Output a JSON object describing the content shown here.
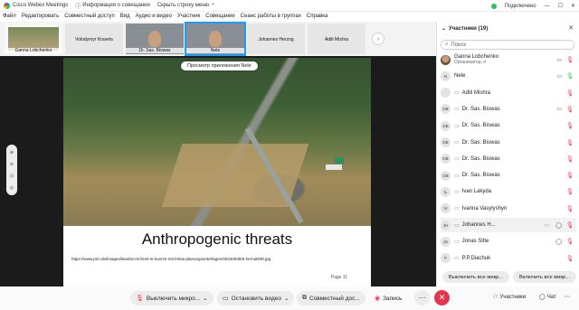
{
  "titlebar": {
    "app_name": "Cisco Webex Meetings",
    "info": "Информация о совещании",
    "hide_strip": "Скрыть строку меню",
    "status": "Подключено"
  },
  "menu": [
    "Файл",
    "Редактировать",
    "Совместный доступ",
    "Вид",
    "Аудио и видео",
    "Участник",
    "Совещание",
    "Сеанс работы в группах",
    "Справка"
  ],
  "strip": {
    "tiles": [
      {
        "name": "Ganna Lobchenko",
        "kind": "slide"
      },
      {
        "name": "Volodymyr Kravets",
        "kind": "blank"
      },
      {
        "name": "Dr. Sas. Biswas",
        "kind": "video"
      },
      {
        "name": "Nele",
        "kind": "video-active"
      },
      {
        "name": "Johannes Herzog",
        "kind": "blank"
      },
      {
        "name": "Aditi Mishra",
        "kind": "blank"
      }
    ]
  },
  "stage": {
    "banner": "Просмотр приложения Nele",
    "slide_title": "Anthropogenic threats",
    "slide_url": "https://www.pnn.de/images/landrat-rechnet-in-kuerze-mit-fmlas-planungsunterlagen/25340948/5-format530.jpg",
    "slide_page": "Page 11"
  },
  "controls": {
    "mute": "Выключить микро...",
    "video": "Остановить видео",
    "share": "Совместный дос...",
    "record": "Запись",
    "participants": "Участники",
    "chat": "Чат"
  },
  "panel": {
    "title": "Участники (19)",
    "search_placeholder": "Поиск",
    "participants": [
      {
        "initials": "",
        "name": "Ganna Lobchenko",
        "sub": "Организатор, я",
        "photo": true,
        "mic": "",
        "right": "▭",
        "mute": "red"
      },
      {
        "initials": "N",
        "name": "Nele",
        "sub": "",
        "photo": false,
        "mic": "",
        "right": "▭",
        "mute": "green"
      },
      {
        "initials": "",
        "name": "Aditi Mishra",
        "sub": "",
        "photo": false,
        "mic": "▭",
        "right": "",
        "mute": "red"
      },
      {
        "initials": "DB",
        "name": "Dr. Sas. Biswas",
        "sub": "",
        "photo": false,
        "mic": "▭",
        "right": "▭",
        "mute": "red"
      },
      {
        "initials": "DB",
        "name": "Dr. Sas. Biswas",
        "sub": "",
        "photo": false,
        "mic": "▭",
        "right": "",
        "mute": "red"
      },
      {
        "initials": "DB",
        "name": "Dr. Sas. Biswas",
        "sub": "",
        "photo": false,
        "mic": "▭",
        "right": "",
        "mute": "red"
      },
      {
        "initials": "DB",
        "name": "Dr. Sas. Biswas",
        "sub": "",
        "photo": false,
        "mic": "▭",
        "right": "",
        "mute": "red"
      },
      {
        "initials": "DB",
        "name": "Dr. Sas. Biswas",
        "sub": "",
        "photo": false,
        "mic": "▭",
        "right": "",
        "mute": "red"
      },
      {
        "initials": "IL",
        "name": "Ivan Lakyda",
        "sub": "",
        "photo": false,
        "mic": "▭",
        "right": "",
        "mute": "red"
      },
      {
        "initials": "IV",
        "name": "Ivanna Vasylyshyn",
        "sub": "",
        "photo": false,
        "mic": "▭",
        "right": "",
        "mute": "red"
      },
      {
        "initials": "JH",
        "name": "Johannes H...",
        "sub": "",
        "photo": false,
        "mic": "▭",
        "right": "◯",
        "mute": "red",
        "extra": "▭",
        "hl": true
      },
      {
        "initials": "JS",
        "name": "Jonas Sitte",
        "sub": "",
        "photo": false,
        "mic": "▭",
        "right": "◯",
        "mute": "red"
      },
      {
        "initials": "P",
        "name": "P.P.Diachuk",
        "sub": "",
        "photo": false,
        "mic": "▭",
        "right": "",
        "mute": "red"
      }
    ],
    "mute_all": "Выключить все микр...",
    "unmute_all": "Включить все микр..."
  }
}
